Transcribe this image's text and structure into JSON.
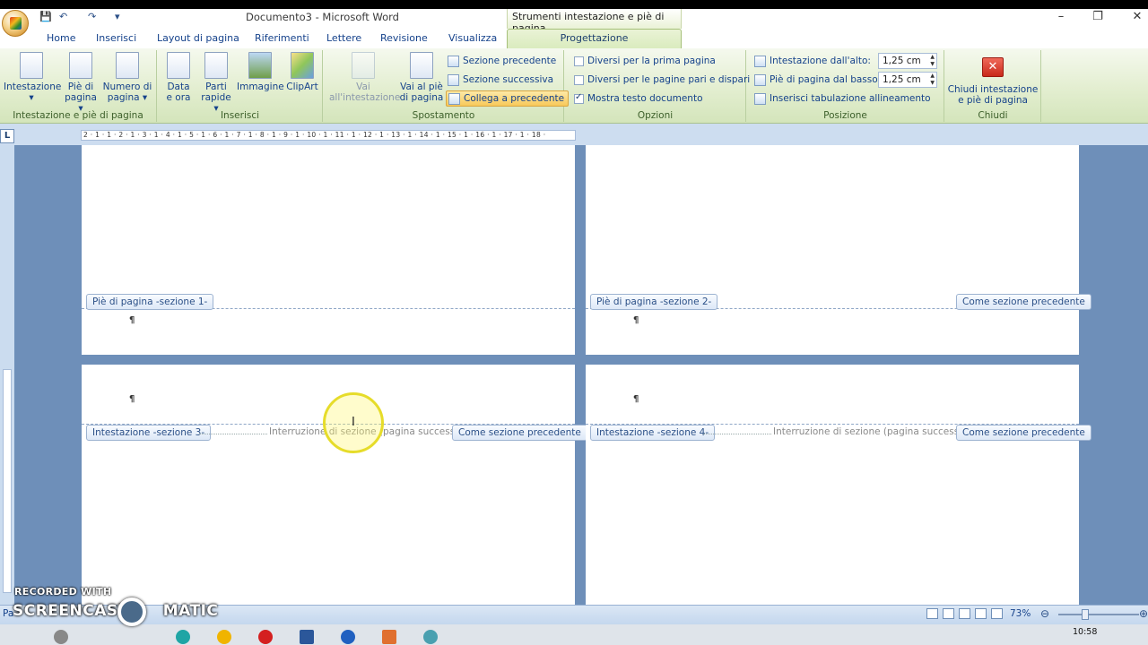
{
  "titlebar": {
    "title": "Documento3 - Microsoft Word",
    "contextual_tools": "Strumenti intestazione e piè di pagina",
    "minimize": "–",
    "restore": "❐",
    "close": "✕"
  },
  "qat": {
    "save": "💾",
    "undo": "↶",
    "redo": "↷",
    "customize": "▾"
  },
  "tabs": [
    "Home",
    "Inserisci",
    "Layout di pagina",
    "Riferimenti",
    "Lettere",
    "Revisione",
    "Visualizza"
  ],
  "active_tab": "Progettazione",
  "ribbon": {
    "group1": {
      "label": "Intestazione e piè di pagina",
      "intestazione": "Intestazione",
      "pie_line1": "Piè di",
      "pie_line2": "pagina ▾",
      "numero_line1": "Numero di",
      "numero_line2": "pagina ▾"
    },
    "group2": {
      "label": "Inserisci",
      "data_line1": "Data",
      "data_line2": "e ora",
      "parti_line1": "Parti",
      "parti_line2": "rapide ▾",
      "immagine": "Immagine",
      "clipart": "ClipArt"
    },
    "group3": {
      "label": "Spostamento",
      "vai_int_line1": "Vai",
      "vai_int_line2": "all'intestazione",
      "vai_pie_line1": "Vai al piè",
      "vai_pie_line2": "di pagina",
      "sezione_precedente": "Sezione precedente",
      "sezione_successiva": "Sezione successiva",
      "collega": "Collega a precedente"
    },
    "group4": {
      "label": "Opzioni",
      "opt1": "Diversi per la prima pagina",
      "opt2": "Diversi per le pagine pari e dispari",
      "opt3": "Mostra testo documento"
    },
    "group5": {
      "label": "Posizione",
      "intestazione_alto": "Intestazione dall'alto:",
      "intestazione_alto_value": "1,25 cm",
      "pie_basso": "Piè di pagina dal basso:",
      "pie_basso_value": "1,25 cm",
      "tabulazione": "Inserisci tabulazione allineamento"
    },
    "group6": {
      "label": "Chiudi",
      "close_line1": "Chiudi intestazione",
      "close_line2": "e piè di pagina"
    }
  },
  "ruler": {
    "ruler_button": "L",
    "ticks": "2 · 1 · 1 · 2 · 1 · 3 · 1 · 4 · 1 · 5 · 1 · 6 · 1 · 7 · 1 · 8 · 1 · 9 · 1 · 10 · 1 · 11 · 1 · 12 · 1 · 13 · 1 · 14 · 1 · 15 · 1 · 16 · 1 · 17 · 1 · 18 ·"
  },
  "document": {
    "footer1": "Piè di pagina -sezione 1-",
    "footer2": "Piè di pagina -sezione 2-",
    "header3": "Intestazione -sezione 3-",
    "header4": "Intestazione -sezione 4-",
    "same_as_previous": "Come sezione precedente",
    "section_break": "Interruzione di sezione (pagina successiva)",
    "pilcrow": "¶"
  },
  "statusbar": {
    "left": "Pa",
    "zoom": "73%",
    "zoom_minus": "⊖",
    "zoom_plus": "⊕"
  },
  "taskbar": {
    "clock": "10:58"
  },
  "watermark": {
    "recorded": "RECORDED WITH",
    "brand_left": "SCREENCAST",
    "brand_right": "MATIC"
  }
}
